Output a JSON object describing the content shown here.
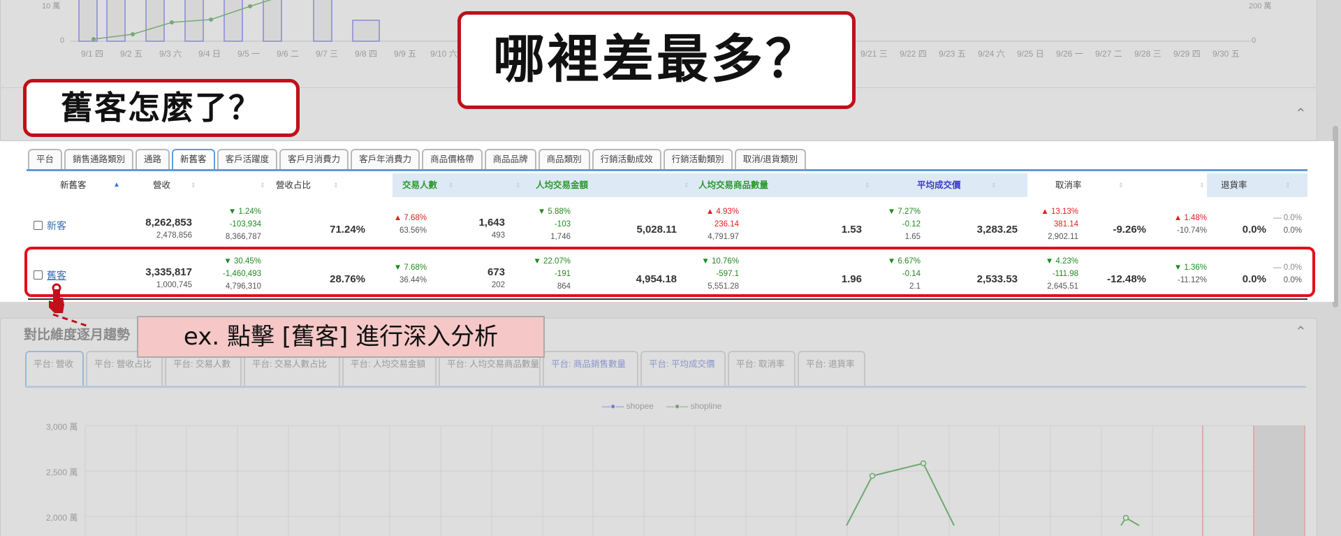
{
  "callouts": {
    "main_question": "哪裡差最多？",
    "old_customer_question": "舊客怎麼了？",
    "hint": "ex. 點擊 [舊客] 進行深入分析"
  },
  "top_chart": {
    "y_left_ticks": [
      "10 萬",
      "0"
    ],
    "y_right_ticks": [
      "200 萬",
      "0"
    ],
    "x_ticks": [
      "9/1 四",
      "9/2 五",
      "9/3 六",
      "9/4 日",
      "9/5 一",
      "9/6 二",
      "9/7 三",
      "9/8 四",
      "9/9 五",
      "9/10 六",
      "9/21 三",
      "9/22 四",
      "9/23 五",
      "9/24 六",
      "9/25 日",
      "9/26 一",
      "9/27 二",
      "9/28 三",
      "9/29 四",
      "9/30 五"
    ]
  },
  "tabs": [
    "平台",
    "銷售通路類別",
    "通路",
    "新舊客",
    "客戶活躍度",
    "客戶月消費力",
    "客戶年消費力",
    "商品價格帶",
    "商品品牌",
    "商品類別",
    "行銷活動成效",
    "行銷活動類別",
    "取消/退貨類別"
  ],
  "active_tab": "新舊客",
  "table": {
    "headers": {
      "segment": "新舊客",
      "revenue": "營收",
      "revenue_share": "營收占比",
      "buyers": "交易人數",
      "avg_spend": "人均交易金額",
      "avg_qty": "人均交易商品數量",
      "avg_order": "平均成交價",
      "cancel_rate": "取消率",
      "return_rate": "退貨率"
    },
    "rows": [
      {
        "segment": "新客",
        "revenue": "8,262,853",
        "revenue_prev": "2,478,856",
        "revenue_pct": "▼ 1.24%",
        "revenue_diff": "-103,934",
        "revenue_base": "8,366,787",
        "share": "71.24%",
        "share_pct": "▲ 7.68%",
        "share_base": "63.56%",
        "buyers": "1,643",
        "buyers_prev": "493",
        "buyers_pct": "▼ 5.88%",
        "buyers_diff": "-103",
        "buyers_base": "1,746",
        "avg_spend": "5,028.11",
        "avg_spend_pct": "▲ 4.93%",
        "avg_spend_diff": "236.14",
        "avg_spend_base": "4,791.97",
        "avg_qty": "1.53",
        "avg_qty_pct": "▼ 7.27%",
        "avg_qty_diff": "-0.12",
        "avg_qty_base": "1.65",
        "avg_order": "3,283.25",
        "avg_order_pct": "▲ 13.13%",
        "avg_order_diff": "381.14",
        "avg_order_base": "2,902.11",
        "cancel": "-9.26%",
        "cancel_pct": "▲ 1.48%",
        "cancel_base": "-10.74%",
        "return": "0.0%",
        "return_pct": "— 0.0%",
        "return_base": "0.0%"
      },
      {
        "segment": "舊客",
        "revenue": "3,335,817",
        "revenue_prev": "1,000,745",
        "revenue_pct": "▼ 30.45%",
        "revenue_diff": "-1,460,493",
        "revenue_base": "4,796,310",
        "share": "28.76%",
        "share_pct": "▼ 7.68%",
        "share_base": "36.44%",
        "buyers": "673",
        "buyers_prev": "202",
        "buyers_pct": "▼ 22.07%",
        "buyers_diff": "-191",
        "buyers_base": "864",
        "avg_spend": "4,954.18",
        "avg_spend_pct": "▼ 10.76%",
        "avg_spend_diff": "-597.1",
        "avg_spend_base": "5,551.28",
        "avg_qty": "1.96",
        "avg_qty_pct": "▼ 6.67%",
        "avg_qty_diff": "-0.14",
        "avg_qty_base": "2.1",
        "avg_order": "2,533.53",
        "avg_order_pct": "▼ 4.23%",
        "avg_order_diff": "-111.98",
        "avg_order_base": "2,645.51",
        "cancel": "-12.48%",
        "cancel_pct": "▼ 1.36%",
        "cancel_base": "-11.12%",
        "return": "0.0%",
        "return_pct": "— 0.0%",
        "return_base": "0.0%"
      }
    ]
  },
  "bottom": {
    "section_title": "對比維度逐月趨勢",
    "tabs": [
      "平台: 營收",
      "平台: 營收占比",
      "平台: 交易人數",
      "平台: 交易人數占比",
      "平台: 人均交易金額",
      "平台: 人均交易商品數量",
      "平台: 商品銷售數量",
      "平台: 平均成交價",
      "平台: 取消率",
      "平台: 退貨率"
    ],
    "legend": [
      "shopee",
      "shopline"
    ],
    "y_ticks": [
      "3,000 萬",
      "2,500 萬",
      "2,000 萬"
    ],
    "colors": {
      "shopee": "#7b7fd6",
      "shopline": "#6fa86f"
    }
  }
}
